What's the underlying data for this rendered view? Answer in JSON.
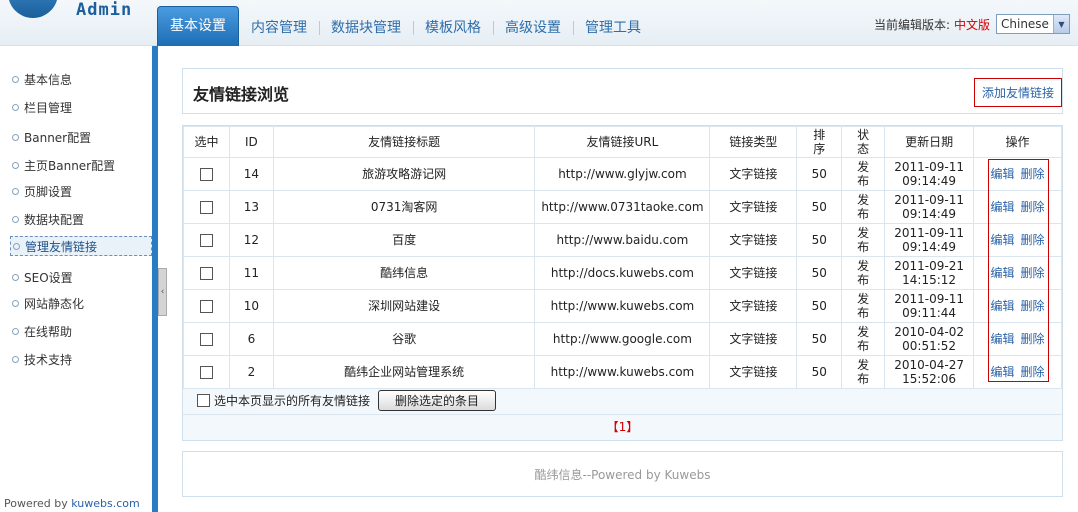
{
  "header": {
    "logo_text": "Admin",
    "nav_tabs": [
      "基本设置",
      "内容管理",
      "数据块管理",
      "模板风格",
      "高级设置",
      "管理工具"
    ],
    "version_label": "当前编辑版本:",
    "current_lang": "中文版",
    "lang_select_value": "Chinese"
  },
  "sidebar": {
    "items": [
      "基本信息",
      "栏目管理",
      "Banner配置",
      "主页Banner配置",
      "页脚设置",
      "数据块配置",
      "管理友情链接",
      "SEO设置",
      "网站静态化",
      "在线帮助",
      "技术支持"
    ],
    "footer_prefix": "Powered by ",
    "footer_link": "kuwebs.com"
  },
  "main": {
    "title": "友情链接浏览",
    "add_button": "添加友情链接",
    "columns": [
      "选中",
      "ID",
      "友情链接标题",
      "友情链接URL",
      "链接类型",
      "排序",
      "状态",
      "更新日期",
      "操作"
    ],
    "rows": [
      {
        "id": "14",
        "title": "旅游攻略游记网",
        "url": "http://www.glyjw.com",
        "type": "文字链接",
        "order": "50",
        "status": "发布",
        "date": "2011-09-11",
        "time": "09:14:49"
      },
      {
        "id": "13",
        "title": "0731淘客网",
        "url": "http://www.0731taoke.com",
        "type": "文字链接",
        "order": "50",
        "status": "发布",
        "date": "2011-09-11",
        "time": "09:14:49"
      },
      {
        "id": "12",
        "title": "百度",
        "url": "http://www.baidu.com",
        "type": "文字链接",
        "order": "50",
        "status": "发布",
        "date": "2011-09-11",
        "time": "09:14:49"
      },
      {
        "id": "11",
        "title": "酷纬信息",
        "url": "http://docs.kuwebs.com",
        "type": "文字链接",
        "order": "50",
        "status": "发布",
        "date": "2011-09-21",
        "time": "14:15:12"
      },
      {
        "id": "10",
        "title": "深圳网站建设",
        "url": "http://www.kuwebs.com",
        "type": "文字链接",
        "order": "50",
        "status": "发布",
        "date": "2011-09-11",
        "time": "09:11:44"
      },
      {
        "id": "6",
        "title": "谷歌",
        "url": "http://www.google.com",
        "type": "文字链接",
        "order": "50",
        "status": "发布",
        "date": "2010-04-02",
        "time": "00:51:52"
      },
      {
        "id": "2",
        "title": "酷纬企业网站管理系统",
        "url": "http://www.kuwebs.com",
        "type": "文字链接",
        "order": "50",
        "status": "发布",
        "date": "2010-04-27",
        "time": "15:52:06"
      }
    ],
    "edit_label": "编辑",
    "delete_label": "删除",
    "select_all_label": "选中本页显示的所有友情链接",
    "delete_selected_button": "删除选定的条目",
    "pager": "【1】"
  },
  "footer": {
    "text": "酷纬信息--Powered by Kuwebs"
  }
}
